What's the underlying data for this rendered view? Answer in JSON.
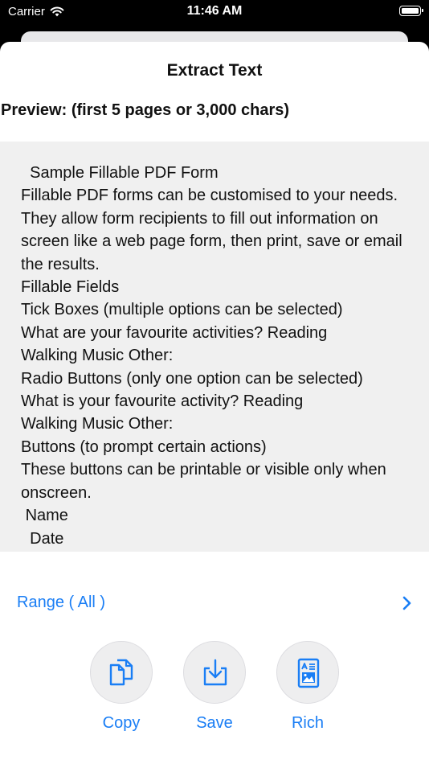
{
  "status_bar": {
    "carrier": "Carrier",
    "time": "11:46 AM"
  },
  "sheet": {
    "title": "Extract Text",
    "preview_label": "Preview: (first 5 pages or 3,000 chars)",
    "preview_text": "  Sample Fillable PDF Form\nFillable PDF forms can be customised to your needs. They allow form recipients to fill out information on screen like a web page form, then print, save or email the results.\nFillable Fields\nTick Boxes (multiple options can be selected)\nWhat are your favourite activities? Reading\nWalking Music Other:\nRadio Buttons (only one option can be selected)\nWhat is your favourite activity? Reading\nWalking Music Other:\nButtons (to prompt certain actions)\nThese buttons can be printable or visible only when onscreen.\n Name\n  Date"
  },
  "range": {
    "label": "Range ( All )"
  },
  "actions": {
    "copy": {
      "label": "Copy",
      "icon": "copy-icon"
    },
    "save": {
      "label": "Save",
      "icon": "save-download-icon"
    },
    "rich": {
      "label": "Rich",
      "icon": "rich-document-icon"
    }
  },
  "colors": {
    "accent": "#1a7ef5",
    "preview_bg": "#f0f0f0"
  }
}
